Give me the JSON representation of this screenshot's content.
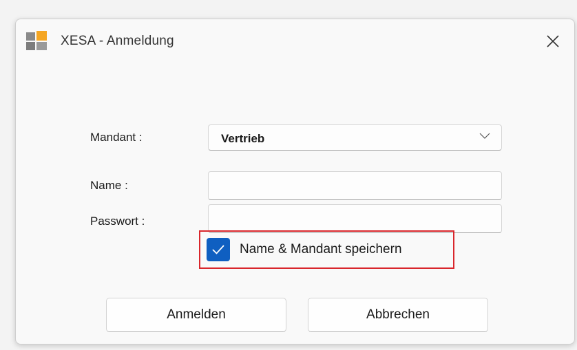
{
  "window": {
    "title": "XESA - Anmeldung",
    "icon": "xesa-app-icon",
    "icon_colors": [
      "#8a8a8a",
      "#f5a623",
      "#8a8a8a",
      "#8a8a8a"
    ]
  },
  "form": {
    "mandant_label": "Mandant :",
    "mandant_value": "Vertrieb",
    "name_label": "Name :",
    "name_value": "",
    "password_label": "Passwort :",
    "password_value": "",
    "save_checkbox_label": "Name & Mandant speichern",
    "save_checked": true
  },
  "buttons": {
    "login": "Anmelden",
    "cancel": "Abbrechen"
  },
  "colors": {
    "accent": "#0f5fc1",
    "highlight": "#d9262c"
  }
}
